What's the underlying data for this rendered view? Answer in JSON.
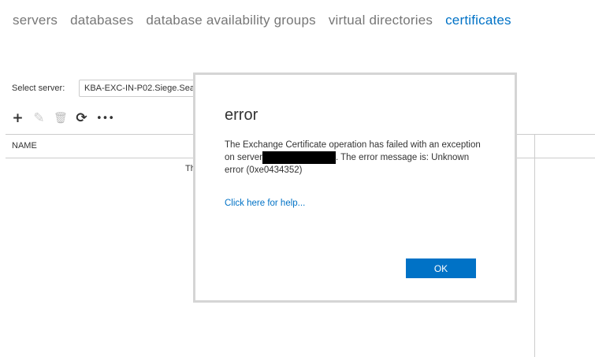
{
  "nav": {
    "tabs": [
      "servers",
      "databases",
      "database availability groups",
      "virtual directories",
      "certificates"
    ],
    "active": "certificates"
  },
  "server_select": {
    "label": "Select server:",
    "value": "KBA-EXC-IN-P02.Siege.Sea"
  },
  "toolbar": {
    "icons": [
      "add-icon",
      "edit-icon",
      "delete-icon",
      "refresh-icon",
      "more-icon"
    ]
  },
  "table": {
    "column": "NAME",
    "partial_text": "Th"
  },
  "dialog": {
    "title": "error",
    "message_part1": "The Exchange Certificate operation has failed with an exception on server",
    "message_part2": ". The error message is: Unknown error (0xe0434352)",
    "help_link": "Click here for help...",
    "ok_label": "OK"
  },
  "colors": {
    "accent": "#0072c6"
  }
}
